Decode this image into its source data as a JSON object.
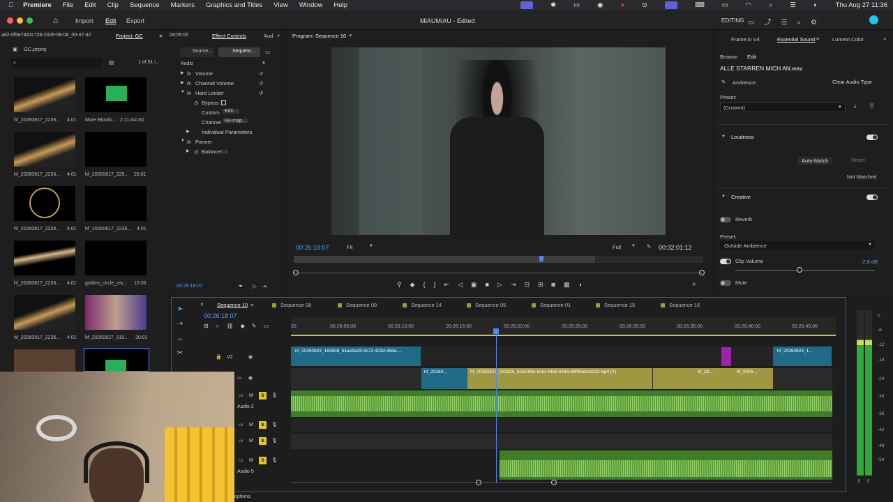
{
  "menubar": {
    "app": "Premiere",
    "items": [
      "File",
      "Edit",
      "Clip",
      "Sequence",
      "Markers",
      "Graphics and Titles",
      "View",
      "Window",
      "Help"
    ],
    "datetime": "Thu Aug 27  11:36"
  },
  "toolbar": {
    "home": "Home",
    "tabs": [
      "Import",
      "Edit",
      "Export"
    ],
    "active_tab": "Edit",
    "doc_title": "MIAUMIAU - Edited",
    "workspace": "EDITING"
  },
  "project": {
    "path": "ad2-0f5e7342c726-2026-08-06_00-47-42",
    "title": "Project: GC",
    "file": "GC.prproj",
    "count": "1 of 51 i...",
    "items": [
      {
        "name": "hf_20260817_2236...",
        "dur": "4:01"
      },
      {
        "name": "More Blockb...",
        "dur": "2:11:44160"
      },
      {
        "name": "hf_20260817_2236...",
        "dur": "4:01"
      },
      {
        "name": "hf_20260817_225...",
        "dur": "25:01"
      },
      {
        "name": "hf_20260817_2236...",
        "dur": "4:01"
      },
      {
        "name": "hf_20260817_2236...",
        "dur": "4:01"
      },
      {
        "name": "hf_20260817_2236...",
        "dur": "4:01"
      },
      {
        "name": "golden_circle_rev...",
        "dur": "15:00"
      },
      {
        "name": "hf_20260817_2236...",
        "dur": "4:01"
      },
      {
        "name": "hf_20260827_010...",
        "dur": "30:01"
      }
    ]
  },
  "effects": {
    "tc_top": ":18:55:00",
    "tabs": [
      "Effect Controls",
      "Aud"
    ],
    "source_tab": "Source...",
    "seq_tab": "Sequenc...",
    "section": "Audio",
    "rows": [
      "Volume",
      "Channel Volume",
      "Hard Limiter"
    ],
    "bypass": "Bypass",
    "custom": "Custom",
    "custom_btn": "Edit...",
    "channel": "Channel",
    "channel_btn": "Re-map...",
    "indiv": "Individual Parameters",
    "panner": "Panner",
    "balance": "Balance",
    "balance_val": "0.0",
    "timecode": "00:26:18:07"
  },
  "program": {
    "title": "Program: Sequence 10",
    "timecode": "00:26:18:07",
    "fit": "Fit",
    "quality": "Full",
    "duration": "00:32:01:12"
  },
  "essential": {
    "tabs": [
      "Frame.io V4",
      "Essential Sound",
      "Lumetri Color"
    ],
    "browse": "Browse",
    "edit": "Edit",
    "filename": "ALLE STARREN MICH AN.wav",
    "type": "Ambience",
    "clear_btn": "Clear Audio Type",
    "preset_label": "Preset:",
    "preset": "(Custom)",
    "loudness": "Loudness",
    "automatch": "Auto-Match",
    "reset": "Reset",
    "not_matched": "Not Matched",
    "creative": "Creative",
    "reverb": "Reverb",
    "preset2_label": "Preset:",
    "preset2": "Outside Ambience",
    "clip_volume": "Clip Volume",
    "clip_volume_val": "-2.8 dB",
    "mute": "Mute"
  },
  "timeline": {
    "timecode": "00:26:18:07",
    "tabs": [
      "Sequence 10",
      "Sequence 08",
      "Sequence 09",
      "Sequence 14",
      "Sequence 05",
      "Sequence 01",
      "Sequence 15",
      "Sequence 16"
    ],
    "ruler": [
      "00",
      "00:26:05:00",
      "00:26:10:00",
      "00:26:15:00",
      "00:26:20:00",
      "00:26:25:00",
      "00:26:30:00",
      "00:26:35:00",
      "00:26:40:00",
      "00:26:45:00"
    ],
    "tracks": {
      "v2": "V2",
      "a2": "Audio 2",
      "a5": "Audio 5",
      "m": "M",
      "s": "S"
    },
    "clips": {
      "v2": "hf_20260823_163508_b1ae9a29-6c72-423d-96da-...",
      "v2b": "hf_20260823_1...",
      "v1a": "hf_20260...",
      "v1b": "hf_20260827_022835_6cfa788e-6cfd-48b9-9448-b9f05bbc3233.mp4 [V]",
      "v1c": "hf_20...",
      "v1d": "hf_2026..."
    }
  },
  "meter": {
    "labels": [
      "0",
      "-6",
      "-12",
      "-18",
      "-24",
      "-30",
      "-36",
      "-42",
      "-48",
      "-54"
    ],
    "s": "S"
  },
  "status": {
    "text": "options."
  }
}
